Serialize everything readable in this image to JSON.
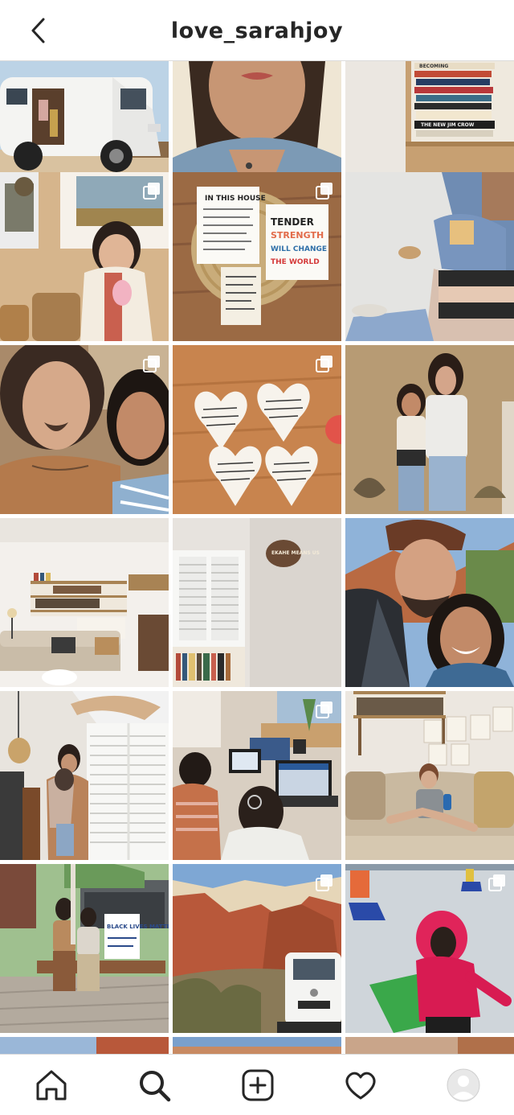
{
  "header": {
    "username": "love_sarahjoy",
    "back_icon": "chevron-left-icon"
  },
  "grid": {
    "posts": [
      {
        "subject": "white van parked in desert with family in doorway",
        "multi": false
      },
      {
        "subject": "woman in denim jacket close-up",
        "multi": false
      },
      {
        "subject": "stack of books on shelf",
        "multi": false,
        "book_titles": [
          "BECOMING",
          "THE NEW JIM CROW"
        ]
      },
      {
        "subject": "girl in cardigan holding toy",
        "multi": true
      },
      {
        "subject": "printed notes on woven placemat",
        "multi": true,
        "card_text": [
          "IN THIS HOUSE",
          "TENDER",
          "STRENGTH",
          "WILL CHANGE",
          "THE WORLD"
        ]
      },
      {
        "subject": "child in denim sitting on floor",
        "multi": false
      },
      {
        "subject": "couple selfie indoors",
        "multi": true
      },
      {
        "subject": "paper hearts with handwritten notes on wood table",
        "multi": true
      },
      {
        "subject": "couple standing by adobe wall",
        "multi": false
      },
      {
        "subject": "living room with bookshelf and sofa",
        "multi": false
      },
      {
        "subject": "white shutters and wall sign",
        "multi": false,
        "sign_text": "EKAHE MEANS US"
      },
      {
        "subject": "couple selfie outdoors at dusk",
        "multi": false
      },
      {
        "subject": "man holding child by window shutters",
        "multi": false
      },
      {
        "subject": "children at laptops",
        "multi": true
      },
      {
        "subject": "toddler sitting on couch",
        "multi": false
      },
      {
        "subject": "couple sitting with protest sign",
        "multi": false,
        "sign_text": "BLACK LIVES MATTER"
      },
      {
        "subject": "red canyon cliffs and van",
        "multi": true
      },
      {
        "subject": "child in pink coat at ice rink",
        "multi": true
      }
    ]
  },
  "bottom_nav": {
    "items": [
      {
        "id": "home",
        "icon": "home-icon"
      },
      {
        "id": "search",
        "icon": "search-icon"
      },
      {
        "id": "create",
        "icon": "plus-square-icon"
      },
      {
        "id": "activity",
        "icon": "heart-icon"
      },
      {
        "id": "profile",
        "icon": "avatar-icon"
      }
    ]
  },
  "colors": {
    "text": "#262626",
    "divider": "#dbdbdb",
    "background": "#ffffff"
  }
}
